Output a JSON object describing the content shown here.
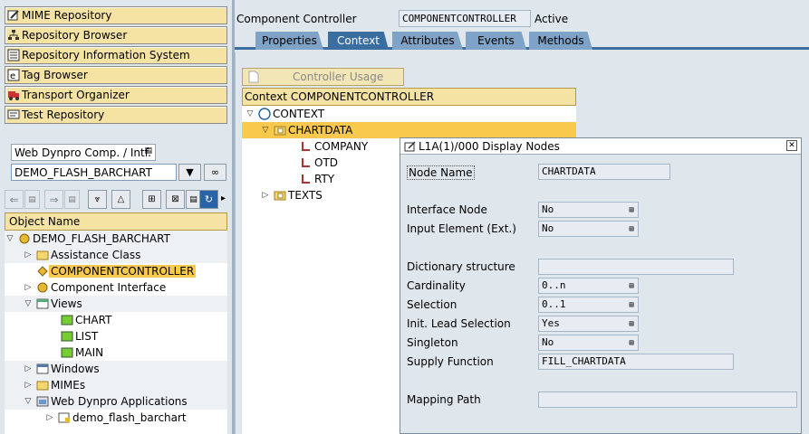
{
  "nav": {
    "mime": "MIME Repository",
    "browser": "Repository Browser",
    "info": "Repository Information System",
    "tag": "Tag Browser",
    "transport": "Transport Organizer",
    "test": "Test Repository"
  },
  "object": {
    "type": "Web Dynpro Comp. / Intf.",
    "name": "DEMO_FLASH_BARCHART"
  },
  "tree": {
    "header": "Object Name",
    "items": [
      {
        "label": "DEMO_FLASH_BARCHART"
      },
      {
        "label": "Assistance Class"
      },
      {
        "label": "COMPONENTCONTROLLER"
      },
      {
        "label": "Component Interface"
      },
      {
        "label": "Views"
      },
      {
        "label": "CHART"
      },
      {
        "label": "LIST"
      },
      {
        "label": "MAIN"
      },
      {
        "label": "Windows"
      },
      {
        "label": "MIMEs"
      },
      {
        "label": "Web Dynpro Applications"
      },
      {
        "label": "demo_flash_barchart"
      }
    ]
  },
  "header": {
    "label": "Component Controller",
    "name": "COMPONENTCONTROLLER",
    "status": "Active"
  },
  "tabs": [
    "Properties",
    "Context",
    "Attributes",
    "Events",
    "Methods"
  ],
  "controller_usage": "Controller Usage",
  "context": {
    "header": "Context COMPONENTCONTROLLER",
    "nodes": [
      "CONTEXT",
      "CHARTDATA",
      "COMPANY",
      "OTD",
      "RTY",
      "TEXTS"
    ]
  },
  "popup": {
    "title": "L1A(1)/000 Display Nodes",
    "fields": {
      "node_name": {
        "label": "Node Name",
        "value": "CHARTDATA"
      },
      "interface_node": {
        "label": "Interface Node",
        "value": "No"
      },
      "input_element": {
        "label": "Input Element (Ext.)",
        "value": "No"
      },
      "dict_structure": {
        "label": "Dictionary structure",
        "value": ""
      },
      "cardinality": {
        "label": "Cardinality",
        "value": "0..n"
      },
      "selection": {
        "label": "Selection",
        "value": "0..1"
      },
      "init_lead": {
        "label": "Init. Lead Selection",
        "value": "Yes"
      },
      "singleton": {
        "label": "Singleton",
        "value": "No"
      },
      "supply_function": {
        "label": "Supply Function",
        "value": "FILL_CHARTDATA"
      },
      "mapping_path": {
        "label": "Mapping Path",
        "value": ""
      }
    }
  }
}
